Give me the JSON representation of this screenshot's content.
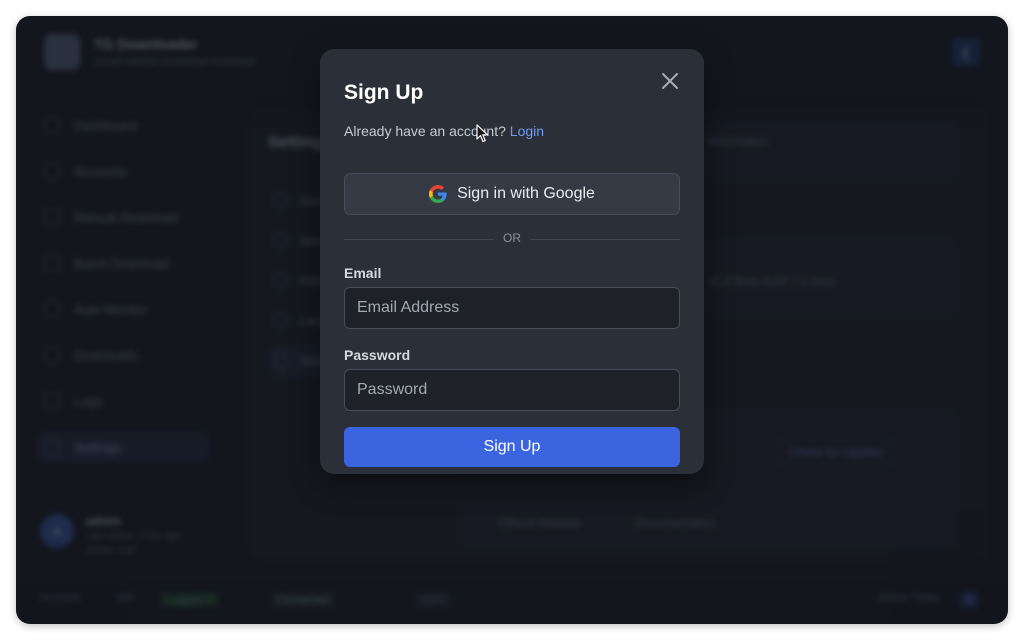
{
  "app": {
    "title": "TG Downloader",
    "subtitle": "Smart Media Download Assistant"
  },
  "sidebar": {
    "items": [
      {
        "label": "Dashboard"
      },
      {
        "label": "Accounts"
      },
      {
        "label": "Manual Download"
      },
      {
        "label": "Batch Download"
      },
      {
        "label": "Auto Monitor"
      },
      {
        "label": "Downloads"
      },
      {
        "label": "Logs"
      },
      {
        "label": "Settings"
      }
    ],
    "user": {
      "avatar_initial": "A",
      "name": "admin",
      "meta_line1": "Last active: 2 hrs ago",
      "meta_line2": "Active user"
    }
  },
  "main": {
    "title": "Settings",
    "nav": [
      {
        "label": "General"
      },
      {
        "label": "Network"
      },
      {
        "label": "Paths"
      },
      {
        "label": "Language"
      },
      {
        "label": "About"
      }
    ],
    "card_text": "Information",
    "card_value": "v1.4 Beta build 7.0 beta",
    "check_update_label": "Check for Update",
    "links": [
      "Official Website",
      "Documentation"
    ]
  },
  "footer": {
    "account_label": "Account",
    "account_value": "N/A",
    "login_badge": "Logged in",
    "connection": "Connected",
    "queue": "Idle/0",
    "active_tasks": "Active Tasks",
    "active_count": "0"
  },
  "modal": {
    "title": "Sign Up",
    "already_text": "Already have an account?",
    "login_link": "Login",
    "google_label": "Sign in with Google",
    "divider_text": "OR",
    "email_label": "Email",
    "email_placeholder": "Email Address",
    "password_label": "Password",
    "password_placeholder": "Password",
    "submit_label": "Sign Up"
  },
  "colors": {
    "accent": "#3b64e0",
    "link": "#6f9bf5",
    "modal_bg": "#2b2f38"
  }
}
